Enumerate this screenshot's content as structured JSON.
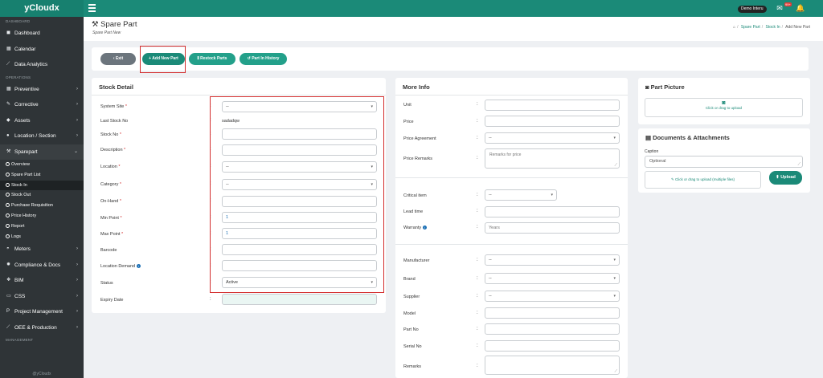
{
  "app": {
    "brand": "yCloudx",
    "demo_badge": "Demo Interu",
    "notif_count": "99+"
  },
  "sidebar": {
    "sections": {
      "dashboard": "DASHBOARD",
      "operations": "OPERATIONS",
      "management": "MANAGEMENT"
    },
    "dashboard_items": [
      {
        "label": "Dashboard",
        "icon": "dashboard-icon"
      },
      {
        "label": "Calendar",
        "icon": "calendar-icon"
      },
      {
        "label": "Data Analytics",
        "icon": "chart-icon"
      }
    ],
    "operations_items": [
      {
        "label": "Preventive",
        "icon": "calendar-check-icon"
      },
      {
        "label": "Corrective",
        "icon": "wrench-icon"
      },
      {
        "label": "Assets",
        "icon": "tag-icon"
      },
      {
        "label": "Location / Section",
        "icon": "location-icon"
      },
      {
        "label": "Sparepart",
        "icon": "tools-icon"
      }
    ],
    "sparepart_sub": [
      {
        "label": "Overview"
      },
      {
        "label": "Spare Part List"
      },
      {
        "label": "Stock In"
      },
      {
        "label": "Stock Out"
      },
      {
        "label": "Purchase Requisition"
      },
      {
        "label": "Price History"
      },
      {
        "label": "Report"
      },
      {
        "label": "Logs"
      }
    ],
    "more_items": [
      {
        "label": "Meters",
        "icon": "meter-icon"
      },
      {
        "label": "Compliance & Docs",
        "icon": "gear-icon"
      },
      {
        "label": "BIM",
        "icon": "cube-icon"
      },
      {
        "label": "CSS",
        "icon": "monitor-icon"
      },
      {
        "label": "Project Management",
        "icon": "project-icon"
      },
      {
        "label": "OEE & Production",
        "icon": "chart-icon"
      }
    ],
    "footer": "@yCloudx"
  },
  "header": {
    "title": "Spare Part",
    "subtitle": "Spare Part New",
    "breadcrumb": [
      "Spare Part",
      "Stock In",
      "Add New Part"
    ]
  },
  "toolbar": {
    "exit": "Exit",
    "add_new_part": "Add New Part",
    "restock_parts": "Restock Parts",
    "part_in_history": "Part In History"
  },
  "stock_detail": {
    "title": "Stock Detail",
    "system_site_label": "System Site",
    "system_site_value": "--",
    "last_stock_no_label": "Last Stock No",
    "last_stock_no_value": "sadadqw",
    "stock_no_label": "Stock No",
    "description_label": "Description",
    "location_label": "Location",
    "location_value": "--",
    "category_label": "Category",
    "category_value": "--",
    "on_hand_label": "On-Hand",
    "min_point_label": "Min Point",
    "min_point_value": "1",
    "max_point_label": "Max Point",
    "max_point_value": "1",
    "barcode_label": "Barcode",
    "location_demand_label": "Location Demand",
    "status_label": "Status",
    "status_value": "Active",
    "expiry_date_label": "Expiry Date",
    "required_mark": "*"
  },
  "more_info": {
    "title": "More Info",
    "unit_label": "Unit",
    "price_label": "Price",
    "price_agreement_label": "Price Agreement",
    "price_agreement_value": "--",
    "price_remarks_label": "Price Remarks",
    "price_remarks_placeholder": "Remarks for price",
    "critical_item_label": "Critical item",
    "critical_item_value": "--",
    "lead_time_label": "Lead time",
    "warranty_label": "Warranty",
    "warranty_placeholder": "Years",
    "manufacturer_label": "Manufacturer",
    "manufacturer_value": "--",
    "brand_label": "Brand",
    "brand_value": "--",
    "supplier_label": "Supplier",
    "supplier_value": "--",
    "model_label": "Model",
    "part_no_label": "Part No",
    "serial_no_label": "Serial No",
    "remarks_label": "Remarks"
  },
  "part_picture": {
    "title": "Part Picture",
    "upload_text": "Click or drag to upload"
  },
  "documents": {
    "title": "Documents & Attachments",
    "caption_label": "Caption",
    "caption_placeholder": "Optional",
    "upload_text": "Click or drag to upload (multiple files)",
    "upload_button": "Upload"
  },
  "colors": {
    "primary": "#1b8a78",
    "sidebar": "#2f3437",
    "highlight": "#d32f2f"
  }
}
